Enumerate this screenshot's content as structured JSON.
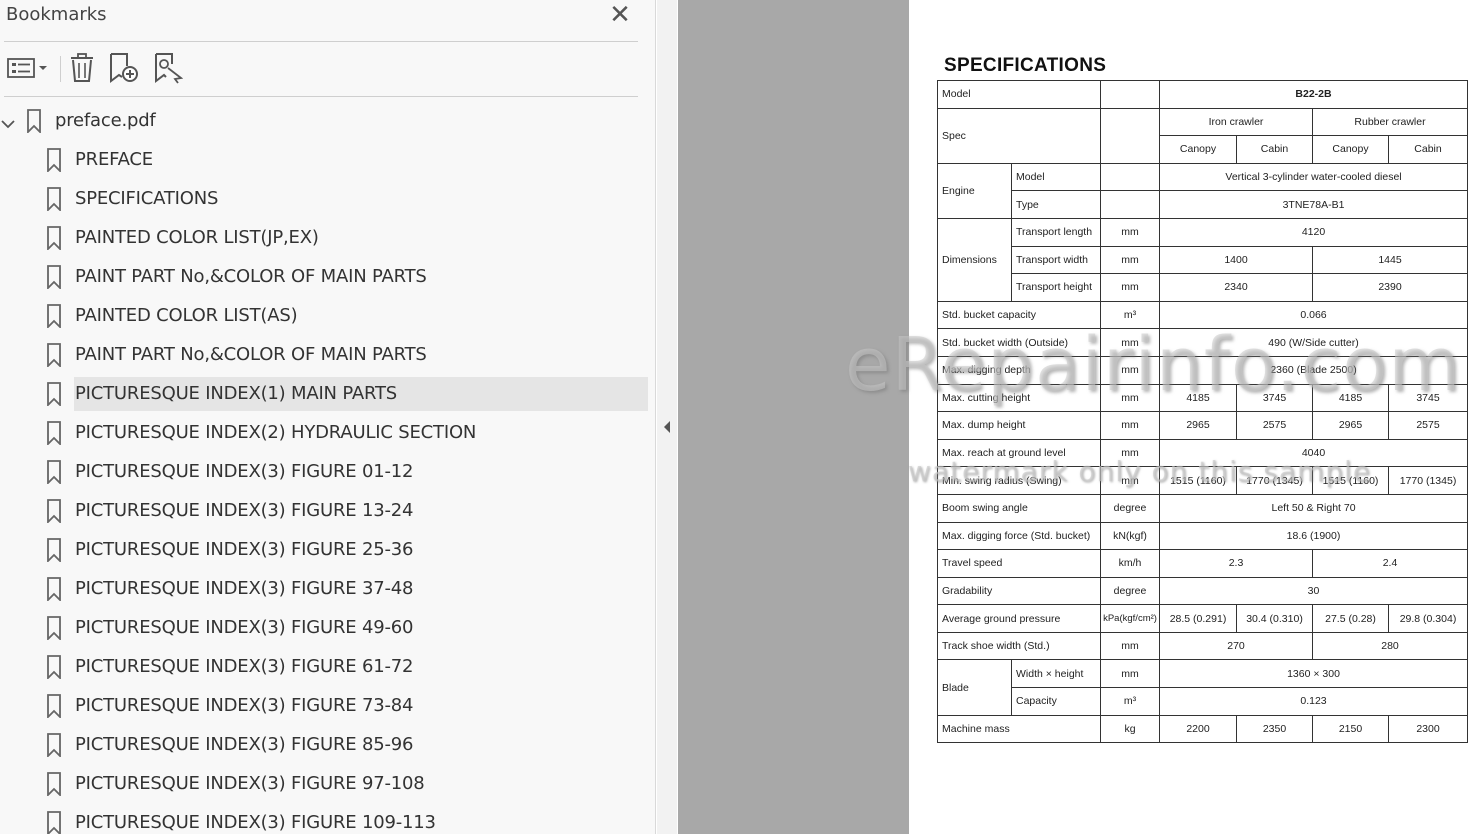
{
  "panel": {
    "title": "Bookmarks",
    "close_glyph": "✕",
    "toolbar": [
      {
        "name": "options-menu-icon"
      },
      {
        "name": "delete-bookmark-icon"
      },
      {
        "name": "new-bookmark-icon"
      },
      {
        "name": "find-bookmark-icon"
      }
    ],
    "root": {
      "label": "preface.pdf",
      "expanded": true
    },
    "items": [
      {
        "label": "PREFACE",
        "selected": false
      },
      {
        "label": "SPECIFICATIONS",
        "selected": false
      },
      {
        "label": "PAINTED COLOR LIST(JP,EX)",
        "selected": false
      },
      {
        "label": "PAINT PART No,&COLOR OF MAIN PARTS",
        "selected": false
      },
      {
        "label": "PAINTED COLOR LIST(AS)",
        "selected": false
      },
      {
        "label": "PAINT PART No,&COLOR OF MAIN PARTS",
        "selected": false
      },
      {
        "label": "PICTURESQUE INDEX(1) MAIN PARTS",
        "selected": true
      },
      {
        "label": "PICTURESQUE INDEX(2) HYDRAULIC SECTION",
        "selected": false
      },
      {
        "label": "PICTURESQUE INDEX(3) FIGURE 01-12",
        "selected": false
      },
      {
        "label": "PICTURESQUE INDEX(3) FIGURE 13-24",
        "selected": false
      },
      {
        "label": "PICTURESQUE INDEX(3) FIGURE 25-36",
        "selected": false
      },
      {
        "label": "PICTURESQUE INDEX(3) FIGURE 37-48",
        "selected": false
      },
      {
        "label": "PICTURESQUE INDEX(3) FIGURE 49-60",
        "selected": false
      },
      {
        "label": "PICTURESQUE INDEX(3) FIGURE 61-72",
        "selected": false
      },
      {
        "label": "PICTURESQUE INDEX(3) FIGURE 73-84",
        "selected": false
      },
      {
        "label": "PICTURESQUE INDEX(3) FIGURE 85-96",
        "selected": false
      },
      {
        "label": "PICTURESQUE INDEX(3) FIGURE 97-108",
        "selected": false
      },
      {
        "label": "PICTURESQUE INDEX(3) FIGURE 109-113",
        "selected": false
      }
    ]
  },
  "document": {
    "title": "SPECIFICATIONS",
    "watermark": "eRepairinfo.com",
    "watermark_note": "watermark only on this sample",
    "spec": {
      "model_label": "Model",
      "model_value": "B22-2B",
      "spec_label": "Spec",
      "iron_crawler": "Iron crawler",
      "rubber_crawler": "Rubber crawler",
      "canopy": "Canopy",
      "cabin": "Cabin",
      "engine_label": "Engine",
      "engine_model_label": "Model",
      "engine_model_value": "Vertical 3-cylinder water-cooled diesel",
      "engine_type_label": "Type",
      "engine_type_value": "3TNE78A-B1",
      "dimensions_label": "Dimensions",
      "transport_length": "Transport length",
      "transport_length_value": "4120",
      "transport_width": "Transport width",
      "transport_width_iron": "1400",
      "transport_width_rubber": "1445",
      "transport_height": "Transport height",
      "transport_height_iron": "2340",
      "transport_height_rubber": "2390",
      "mm": "mm",
      "m3": "m³",
      "bucket_capacity": "Std. bucket capacity",
      "bucket_capacity_value": "0.066",
      "bucket_width": "Std. bucket width (Outside)",
      "bucket_width_value": "490 (W/Side cutter)",
      "digging_depth": "Max. digging depth",
      "digging_depth_value": "2360 (Blade 2500)",
      "cutting_height": "Max. cutting height",
      "cutting_height_values": [
        "4185",
        "3745",
        "4185",
        "3745"
      ],
      "dump_height": "Max. dump height",
      "dump_height_values": [
        "2965",
        "2575",
        "2965",
        "2575"
      ],
      "reach": "Max. reach at ground level",
      "reach_value": "4040",
      "swing_radius": "Min. swing radius (Swing)",
      "swing_radius_values": [
        "1515 (1160)",
        "1770 (1345)",
        "1515 (1160)",
        "1770 (1345)"
      ],
      "boom_swing": "Boom swing angle",
      "degree": "degree",
      "boom_swing_value": "Left 50 & Right 70",
      "digging_force": "Max. digging force (Std. bucket)",
      "digging_force_unit": "kN(kgf)",
      "digging_force_value": "18.6 (1900)",
      "travel_speed": "Travel speed",
      "travel_speed_unit": "km/h",
      "travel_speed_iron": "2.3",
      "travel_speed_rubber": "2.4",
      "gradability": "Gradability",
      "gradability_value": "30",
      "ground_pressure": "Average ground pressure",
      "ground_pressure_unit": "kPa(kgf/cm²)",
      "ground_pressure_values": [
        "28.5 (0.291)",
        "30.4 (0.310)",
        "27.5 (0.28)",
        "29.8 (0.304)"
      ],
      "shoe_width": "Track shoe width (Std.)",
      "shoe_width_iron": "270",
      "shoe_width_rubber": "280",
      "blade_label": "Blade",
      "blade_wh": "Width × height",
      "blade_wh_value": "1360 × 300",
      "blade_capacity": "Capacity",
      "blade_capacity_value": "0.123",
      "machine_mass": "Machine mass",
      "kg": "kg",
      "machine_mass_values": [
        "2200",
        "2350",
        "2150",
        "2300"
      ]
    }
  }
}
